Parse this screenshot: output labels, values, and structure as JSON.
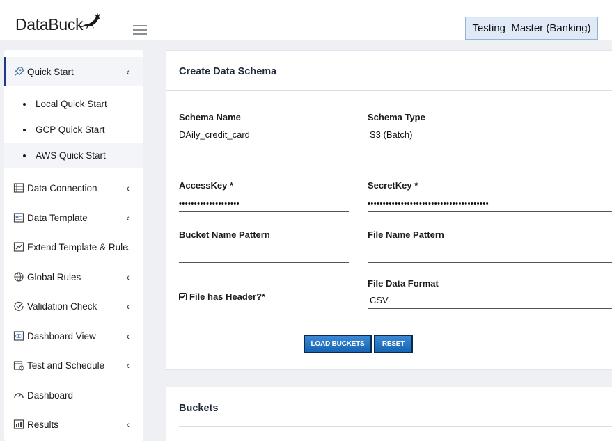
{
  "header": {
    "logo_text": "DataBuck",
    "project": "Testing_Master (Banking)"
  },
  "sidebar": {
    "quick_start": "Quick Start",
    "sub_items": [
      "Local Quick Start",
      "GCP Quick Start",
      "AWS Quick Start"
    ],
    "items": [
      {
        "label": "Data Connection",
        "icon": "database-list-icon"
      },
      {
        "label": "Data Template",
        "icon": "template-icon"
      },
      {
        "label": "Extend Template & Rule",
        "icon": "extend-template-icon"
      },
      {
        "label": "Global Rules",
        "icon": "globe-icon"
      },
      {
        "label": "Validation Check",
        "icon": "check-circle-icon"
      },
      {
        "label": "Dashboard View",
        "icon": "eye-icon"
      },
      {
        "label": "Test and Schedule",
        "icon": "calendar-icon"
      },
      {
        "label": "Dashboard",
        "icon": "gauge-icon"
      },
      {
        "label": "Results",
        "icon": "results-icon"
      }
    ],
    "chevron": "‹"
  },
  "form": {
    "title": "Create Data Schema",
    "schema_name_label": "Schema Name",
    "schema_name_value": "DAily_credit_card",
    "schema_type_label": "Schema Type",
    "schema_type_value": "S3 (Batch)",
    "access_key_label": "AccessKey *",
    "access_key_value": "••••••••••••••••••••",
    "secret_key_label": "SecretKey *",
    "secret_key_value": "••••••••••••••••••••••••••••••••••••••••",
    "bucket_pattern_label": "Bucket Name Pattern",
    "bucket_pattern_value": "",
    "file_pattern_label": "File Name Pattern",
    "file_pattern_value": "",
    "header_checkbox_label": "File has Header?*",
    "file_format_label": "File Data Format",
    "file_format_value": "CSV",
    "load_button": "LOAD BUCKETS",
    "reset_button": "RESET"
  },
  "buckets": {
    "title": "Buckets"
  },
  "colors": {
    "accent": "#1e3a8a",
    "button": "#1e6fc2",
    "project_bg": "#dfeaf6"
  }
}
